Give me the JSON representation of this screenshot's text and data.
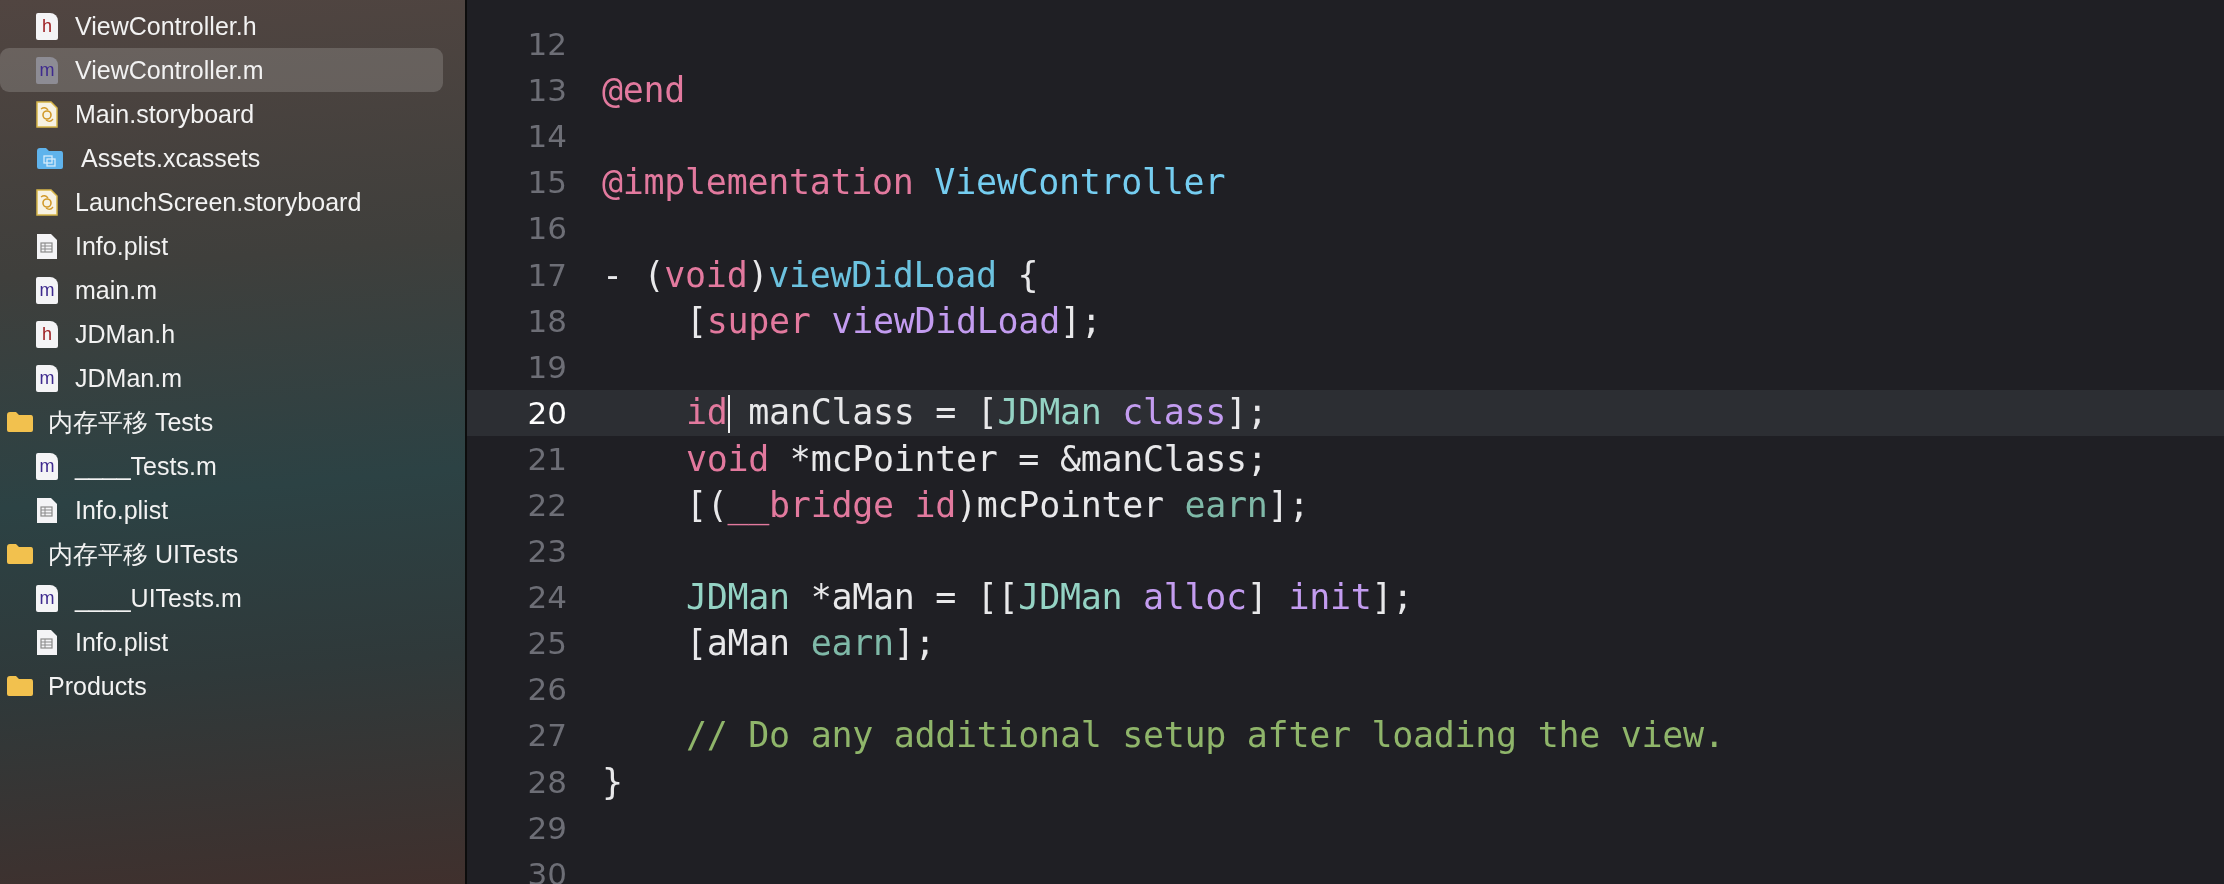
{
  "sidebar": {
    "files": [
      {
        "name": "ViewController.h",
        "kind": "header",
        "icon_text": "h",
        "selected": false
      },
      {
        "name": "ViewController.m",
        "kind": "source",
        "icon_text": "m",
        "selected": true
      },
      {
        "name": "Main.storyboard",
        "kind": "storyboard",
        "selected": false
      },
      {
        "name": "Assets.xcassets",
        "kind": "assets",
        "selected": false
      },
      {
        "name": "LaunchScreen.storyboard",
        "kind": "storyboard",
        "selected": false
      },
      {
        "name": "Info.plist",
        "kind": "plist",
        "selected": false
      },
      {
        "name": "main.m",
        "kind": "source",
        "icon_text": "m",
        "selected": false
      },
      {
        "name": "JDMan.h",
        "kind": "header",
        "icon_text": "h",
        "selected": false
      },
      {
        "name": "JDMan.m",
        "kind": "source",
        "icon_text": "m",
        "selected": false
      }
    ],
    "folders": [
      {
        "name": "内存平移 Tests",
        "selected": false,
        "children": [
          {
            "name": "____Tests.m",
            "kind": "source",
            "icon_text": "m",
            "selected": false
          },
          {
            "name": "Info.plist",
            "kind": "plist",
            "selected": false
          }
        ]
      },
      {
        "name": "内存平移 UITests",
        "selected": false,
        "children": [
          {
            "name": "____UITests.m",
            "kind": "source",
            "icon_text": "m",
            "selected": false
          },
          {
            "name": "Info.plist",
            "kind": "plist",
            "selected": false
          }
        ]
      },
      {
        "name": "Products",
        "selected": false
      }
    ]
  },
  "editor": {
    "lines": [
      {
        "number": "12",
        "current": false
      },
      {
        "number": "13",
        "current": false,
        "tokens": [
          {
            "text": "@end",
            "kind": "keyword"
          }
        ]
      },
      {
        "number": "14",
        "current": false
      },
      {
        "number": "15",
        "current": false,
        "tokens": [
          {
            "text": "@implementation ",
            "kind": "keyword"
          },
          {
            "text": "ViewController",
            "kind": "type"
          }
        ]
      },
      {
        "number": "16",
        "current": false
      },
      {
        "number": "17",
        "current": false,
        "tokens": [
          {
            "text": "- (",
            "kind": "plain"
          },
          {
            "text": "void",
            "kind": "keyword"
          },
          {
            "text": ")",
            "kind": "plain"
          },
          {
            "text": "viewDidLoad",
            "kind": "declaration"
          },
          {
            "text": " {",
            "kind": "plain"
          }
        ]
      },
      {
        "number": "18",
        "current": false,
        "indented": true,
        "tokens": [
          {
            "text": "[",
            "kind": "plain"
          },
          {
            "text": "super ",
            "kind": "keyword"
          },
          {
            "text": "viewDidLoad",
            "kind": "method"
          },
          {
            "text": "];",
            "kind": "plain"
          }
        ]
      },
      {
        "number": "19",
        "current": false
      },
      {
        "number": "20",
        "current": true,
        "indented": true,
        "tokens": [
          {
            "text": "id",
            "kind": "keyword"
          },
          {
            "kind": "cursor"
          },
          {
            "text": " manClass = [",
            "kind": "plain"
          },
          {
            "text": "JDMan ",
            "kind": "project_type"
          },
          {
            "text": "class",
            "kind": "method"
          },
          {
            "text": "];",
            "kind": "plain"
          }
        ]
      },
      {
        "number": "21",
        "current": false,
        "indented": true,
        "tokens": [
          {
            "text": "void",
            "kind": "keyword"
          },
          {
            "text": " *mcPointer = &manClass;",
            "kind": "plain"
          }
        ]
      },
      {
        "number": "22",
        "current": false,
        "indented": true,
        "tokens": [
          {
            "text": "[(",
            "kind": "plain"
          },
          {
            "text": "__bridge ",
            "kind": "keyword"
          },
          {
            "text": "id",
            "kind": "keyword"
          },
          {
            "text": ")mcPointer ",
            "kind": "plain"
          },
          {
            "text": "earn",
            "kind": "project_method"
          },
          {
            "text": "];",
            "kind": "plain"
          }
        ]
      },
      {
        "number": "23",
        "current": false
      },
      {
        "number": "24",
        "current": false,
        "indented": true,
        "tokens": [
          {
            "text": "JDMan",
            "kind": "project_type"
          },
          {
            "text": " *aMan = [[",
            "kind": "plain"
          },
          {
            "text": "JDMan ",
            "kind": "project_type"
          },
          {
            "text": "alloc",
            "kind": "method"
          },
          {
            "text": "] ",
            "kind": "plain"
          },
          {
            "text": "init",
            "kind": "method"
          },
          {
            "text": "];",
            "kind": "plain"
          }
        ]
      },
      {
        "number": "25",
        "current": false,
        "indented": true,
        "tokens": [
          {
            "text": "[aMan ",
            "kind": "plain"
          },
          {
            "text": "earn",
            "kind": "project_method"
          },
          {
            "text": "];",
            "kind": "plain"
          }
        ]
      },
      {
        "number": "26",
        "current": false
      },
      {
        "number": "27",
        "current": false,
        "indented": true,
        "tokens": [
          {
            "text": "// Do any additional setup after loading the view.",
            "kind": "comment"
          }
        ]
      },
      {
        "number": "28",
        "current": false,
        "tokens": [
          {
            "text": "}",
            "kind": "plain"
          }
        ]
      },
      {
        "number": "29",
        "current": false
      },
      {
        "number": "30",
        "current": false
      }
    ]
  }
}
